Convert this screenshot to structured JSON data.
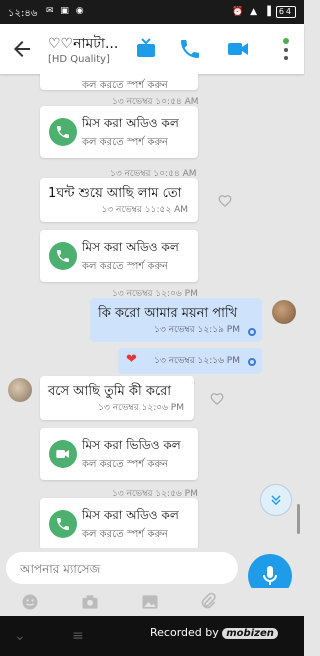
{
  "status_bar": {
    "time": "১২:৪৬",
    "icons": "✉ ▣ ◉",
    "right_icons": "⏰ ▲ ▐",
    "battery": "64"
  },
  "header": {
    "title": "♡♡নামটা...",
    "subtitle": "[HD Quality]"
  },
  "messages": [
    {
      "type": "timestamp",
      "text": "১৩ নভেম্বর ১০:৫৪ AM"
    },
    {
      "type": "missed_call",
      "title": "মিস করা অডিও কল",
      "sub": "কল করতে স্পর্শ করুন"
    },
    {
      "type": "timestamp",
      "text": "১৩ নভেম্বর ১০:৫৪ AM"
    },
    {
      "type": "incoming",
      "text": "1ঘন্ট শুয়ে আছি লাম তো",
      "time": "১৩ নভেম্বর ১১:৫২ AM"
    },
    {
      "type": "missed_call",
      "title": "মিস করা অডিও কল",
      "sub": "কল করতে স্পর্শ করুন"
    },
    {
      "type": "timestamp",
      "text": "১৩ নভেম্বর ১২:০৬ PM"
    },
    {
      "type": "outgoing",
      "text": "কি করো আমার ময়না পাখি",
      "time": "১৩ নভেম্বর ১২:১৯ PM"
    },
    {
      "type": "outgoing",
      "text": "❤",
      "time": "১৩ নভেম্বর ১২:১৬ PM"
    },
    {
      "type": "incoming",
      "text": "বসে আছি তুমি কী করো",
      "time": "১৩ নভেম্বর ১২:০৬ PM"
    },
    {
      "type": "missed_video",
      "title": "মিস করা ভিডিও কল",
      "sub": "কল করতে স্পর্শ করুন"
    },
    {
      "type": "timestamp",
      "text": "১৩ নভেম্বর ১২:৫৬ PM"
    },
    {
      "type": "missed_call",
      "title": "মিস করা অডিও কল",
      "sub": "কল করতে স্পর্শ করুন"
    }
  ],
  "input": {
    "placeholder": "আপনার ম্যাসেজ"
  },
  "toolbar_icons": [
    "emoji-icon",
    "camera-icon",
    "gallery-icon",
    "attach-icon"
  ],
  "watermark": {
    "recorded": "Recorded by",
    "brand": "mobizen"
  },
  "colors": {
    "accent": "#1e9be9",
    "call_green": "#4db06f",
    "outgoing_bubble": "#cfe2fb"
  }
}
